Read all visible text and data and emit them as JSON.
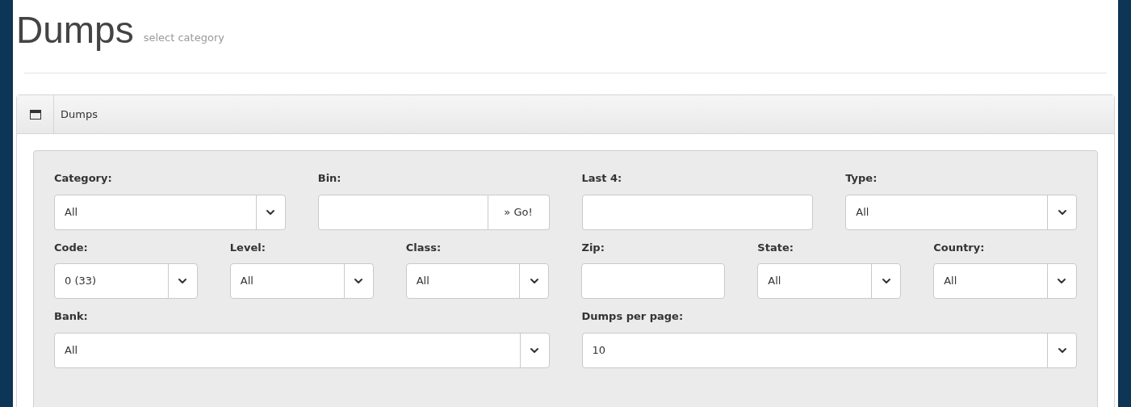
{
  "page": {
    "title": "Dumps",
    "subtitle": "select category"
  },
  "panel": {
    "title": "Dumps"
  },
  "rows": [
    [
      {
        "kind": "select",
        "label": "Category:",
        "value": "All"
      },
      {
        "kind": "input_button",
        "label": "Bin:",
        "button": "» Go!"
      },
      {
        "kind": "input",
        "label": "Last 4:"
      },
      {
        "kind": "select",
        "label": "Type:",
        "value": "All"
      }
    ],
    [
      {
        "kind": "select",
        "label": "Code:",
        "value": "0 (33)"
      },
      {
        "kind": "select",
        "label": "Level:",
        "value": "All"
      },
      {
        "kind": "select",
        "label": "Class:",
        "value": "All"
      },
      {
        "kind": "input",
        "label": "Zip:"
      },
      {
        "kind": "select",
        "label": "State:",
        "value": "All"
      },
      {
        "kind": "select",
        "label": "Country:",
        "value": "All"
      }
    ],
    [
      {
        "kind": "select",
        "label": "Bank:",
        "value": "All"
      },
      {
        "kind": "select",
        "label": "Dumps per page:",
        "value": "10"
      }
    ]
  ]
}
